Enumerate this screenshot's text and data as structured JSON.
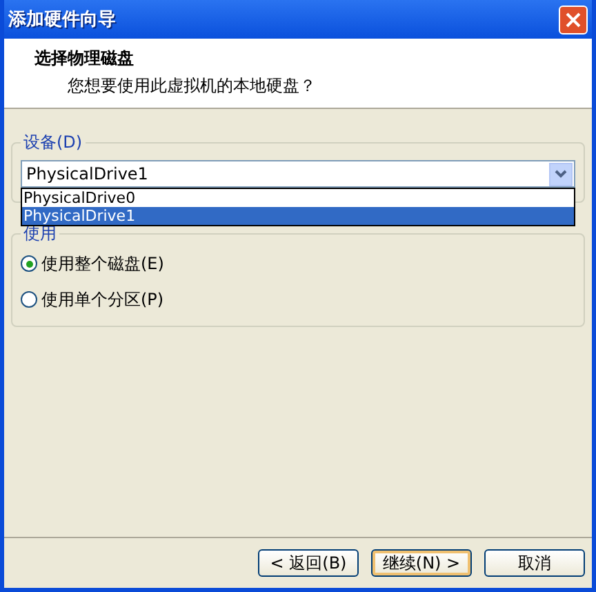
{
  "window": {
    "title": "添加硬件向导"
  },
  "header": {
    "title": "选择物理磁盘",
    "subtitle": "您想要使用此虚拟机的本地硬盘？"
  },
  "device_group": {
    "label": "设备(D)",
    "combo": {
      "value": "PhysicalDrive1",
      "expanded": true,
      "options": [
        {
          "label": "PhysicalDrive0",
          "selected": false
        },
        {
          "label": "PhysicalDrive1",
          "selected": true
        }
      ]
    }
  },
  "usage_group": {
    "label": "使用",
    "options": [
      {
        "label": "使用整个磁盘(E)",
        "selected": true
      },
      {
        "label": "使用单个分区(P)",
        "selected": false
      }
    ]
  },
  "buttons": [
    {
      "label": "< 返回(B)",
      "default": false
    },
    {
      "label": "继续(N) >",
      "default": true
    },
    {
      "label": "取消",
      "default": false
    }
  ]
}
